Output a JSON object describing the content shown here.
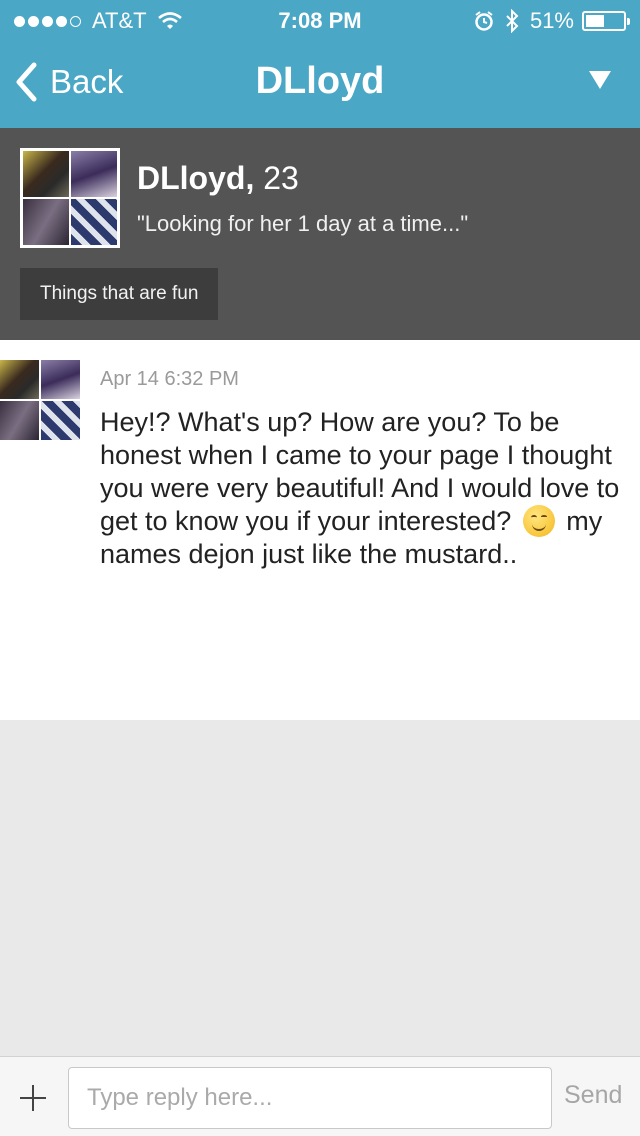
{
  "status_bar": {
    "carrier": "AT&T",
    "time": "7:08 PM",
    "battery": "51%",
    "battery_level": 0.51,
    "signal_bars_filled": 4,
    "signal_bars_total": 5
  },
  "nav": {
    "back_label": "Back",
    "title": "DLloyd",
    "menu_icon": "triangle-down-icon"
  },
  "profile": {
    "name": "DLloyd",
    "age_separator": ",",
    "age": "23",
    "tagline": "\"Looking for her 1 day at a time...\"",
    "interest_chip": "Things that are fun"
  },
  "message": {
    "timestamp": "Apr 14 6:32 PM",
    "text_before_emoji": "Hey!? What's up? How are you? To be honest when I came to your page I thought you were very beautiful! And I would love to get to know you if your interested?",
    "emoji": "smiling-face-icon",
    "text_after_emoji": "my names dejon just like the mustard.."
  },
  "reply": {
    "placeholder": "Type reply here...",
    "value": "",
    "send_label": "Send",
    "add_icon": "plus-icon"
  },
  "colors": {
    "nav_bar": "#4aa7c5",
    "profile_bg": "#545454",
    "chip_bg": "#3d3d3d",
    "page_bg": "#e9e9e9"
  }
}
